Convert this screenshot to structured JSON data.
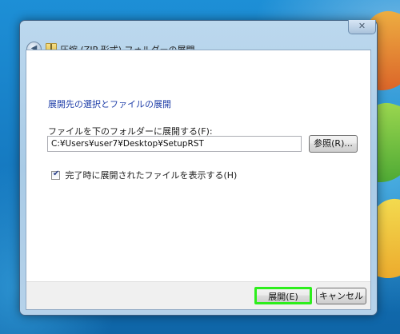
{
  "window": {
    "title": "圧縮 (ZIP 形式) フォルダーの展開",
    "close_glyph": "✕"
  },
  "content": {
    "heading": "展開先の選択とファイルの展開",
    "field_label": "ファイルを下のフォルダーに展開する(F):",
    "path_value": "C:¥Users¥user7¥Desktop¥SetupRST",
    "browse_label": "参照(R)...",
    "checkbox_label": "完了時に展開されたファイルを表示する(H)",
    "checkbox_checked": true
  },
  "footer": {
    "extract_label": "展開(E)",
    "cancel_label": "キャンセル"
  },
  "colors": {
    "heading": "#1f3ea8",
    "highlight": "#2dee1c",
    "desktop": "#1a86c9"
  },
  "icons": {
    "back": "back-arrow-icon",
    "folder": "zip-folder-icon",
    "check": "checkmark-icon"
  }
}
